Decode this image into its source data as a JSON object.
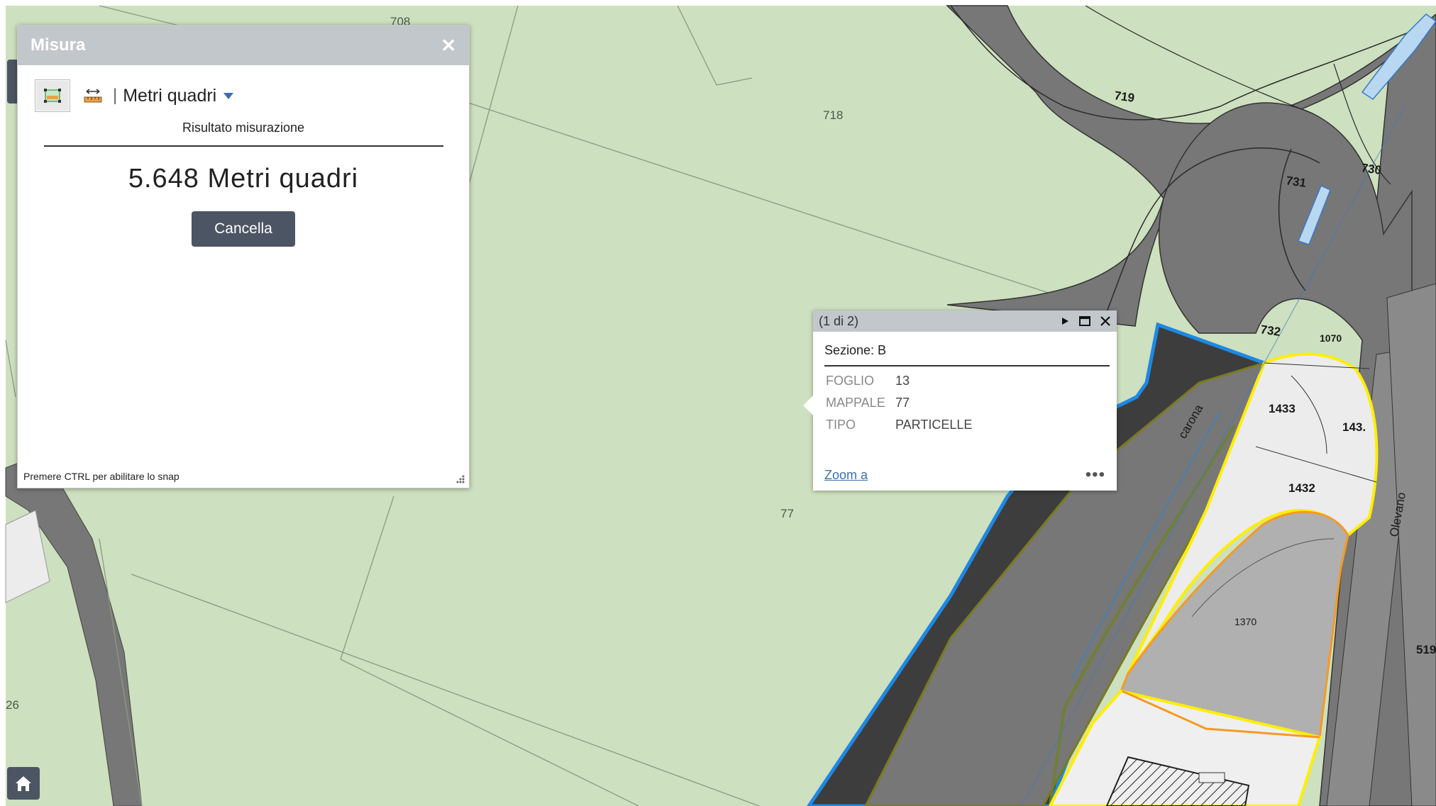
{
  "map": {
    "parcel_labels": [
      "708",
      "718",
      "77",
      "26"
    ],
    "road_labels": [
      "719",
      "731",
      "730",
      "732",
      "1070",
      "1433",
      "143.",
      "1432",
      "1370",
      "519",
      "carona",
      "Olevano"
    ]
  },
  "measure_widget": {
    "title": "Misura",
    "unit": "Metri quadri",
    "result_label": "Risultato misurazione",
    "result_value": "5.648 Metri quadri",
    "clear_label": "Cancella",
    "snap_hint": "Premere CTRL per abilitare lo snap"
  },
  "popup": {
    "page": "(1 di 2)",
    "title": "Sezione: B",
    "attributes": [
      {
        "key": "FOGLIO",
        "value": "13"
      },
      {
        "key": "MAPPALE",
        "value": "77"
      },
      {
        "key": "TIPO",
        "value": "PARTICELLE"
      }
    ],
    "zoom_label": "Zoom a",
    "more_label": "•••"
  },
  "icons": [
    "measure-area-icon",
    "measure-distance-icon",
    "close-icon",
    "next-feature-icon",
    "maximize-icon",
    "home-icon"
  ],
  "colors": {
    "land": "#cde0bf",
    "road": "#777777",
    "selected_outline": "#1e88e5",
    "highlight": "#ffee00",
    "orange_parcel": "#f59a23"
  }
}
